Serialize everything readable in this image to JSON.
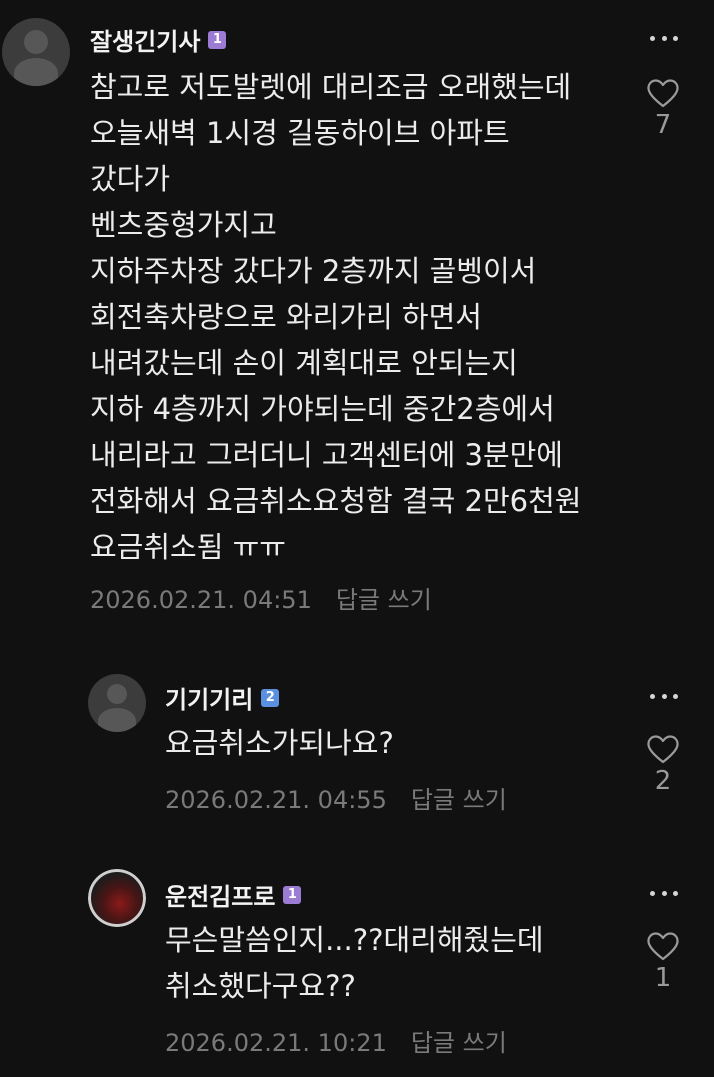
{
  "colors": {
    "background": "#111111",
    "text": "#ececec",
    "meta": "#7a7a7a",
    "badge_level1": "#9b7bd4",
    "badge_level2": "#5b8fe0"
  },
  "comments": [
    {
      "author": "잘생긴기사",
      "badge": "1",
      "avatar": "default-profile",
      "text": "참고로 저도발렛에 대리조금 오래했는데\n오늘새벽 1시경 길동하이브 아파트\n갔다가\n벤츠중형가지고\n지하주차장 갔다가 2층까지 골벵이서\n회전축차량으로 와리가리 하면서\n내려갔는데 손이 계획대로 안되는지\n지하 4층까지 가야되는데 중간2층에서\n내리라고 그러더니 고객센터에 3분만에\n전화해서 요금취소요청함 결국 2만6천원\n요금취소됨 ㅠㅠ",
      "timestamp": "2026.02.21. 04:51",
      "reply_label": "답글 쓰기",
      "likes": "7"
    },
    {
      "author": "기기기리",
      "badge": "2",
      "avatar": "default-profile",
      "text": "요금취소가되나요?",
      "timestamp": "2026.02.21. 04:55",
      "reply_label": "답글 쓰기",
      "likes": "2"
    },
    {
      "author": "운전김프로",
      "badge": "1",
      "avatar": "photo-profile",
      "text": "무슨말씀인지...??대리해줬는데\n취소했다구요??",
      "timestamp": "2026.02.21. 10:21",
      "reply_label": "답글 쓰기",
      "likes": "1"
    }
  ]
}
